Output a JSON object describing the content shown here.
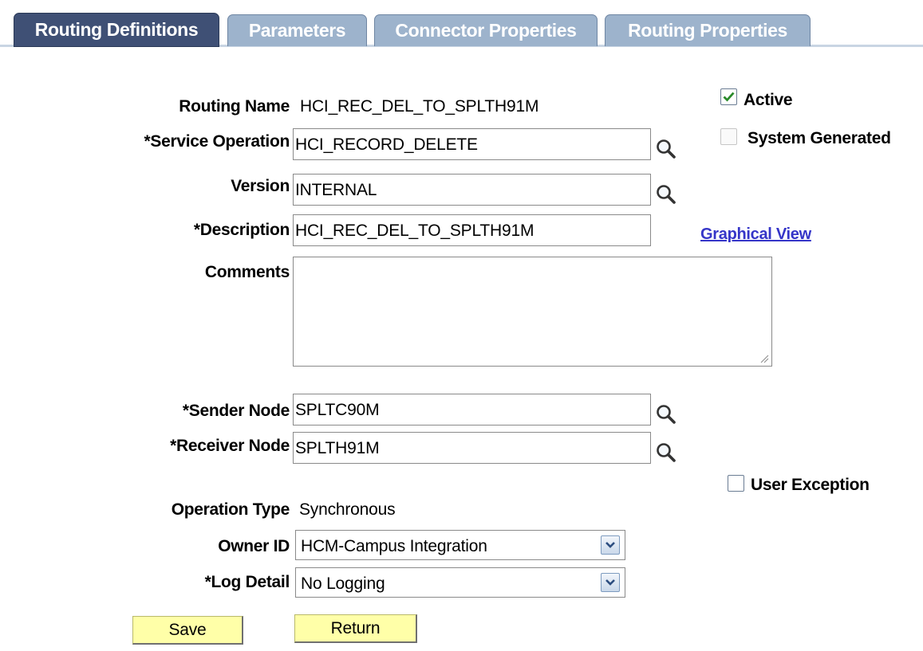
{
  "tabs": [
    {
      "label": "Routing Definitions",
      "active": true
    },
    {
      "label": "Parameters",
      "active": false
    },
    {
      "label": "Connector Properties",
      "active": false
    },
    {
      "label": "Routing Properties",
      "active": false
    }
  ],
  "form": {
    "routing_name": {
      "label": "Routing Name",
      "value": "HCI_REC_DEL_TO_SPLTH91M"
    },
    "service_operation": {
      "label": "*Service Operation",
      "value": "HCI_RECORD_DELETE"
    },
    "version": {
      "label": "Version",
      "value": "INTERNAL"
    },
    "description": {
      "label": "*Description",
      "value": "HCI_REC_DEL_TO_SPLTH91M"
    },
    "comments": {
      "label": "Comments",
      "value": ""
    },
    "sender_node": {
      "label": "*Sender Node",
      "value": "SPLTC90M"
    },
    "receiver_node": {
      "label": "*Receiver Node",
      "value": "SPLTH91M"
    },
    "operation_type": {
      "label": "Operation Type",
      "value": "Synchronous"
    },
    "owner_id": {
      "label": "Owner ID",
      "value": "HCM-Campus Integration"
    },
    "log_detail": {
      "label": "*Log Detail",
      "value": "No Logging"
    }
  },
  "checkboxes": {
    "active": {
      "label": "Active",
      "checked": true
    },
    "system_generated": {
      "label": "System Generated",
      "checked": false,
      "disabled": true
    },
    "user_exception": {
      "label": "User Exception",
      "checked": false
    }
  },
  "links": {
    "graphical_view": "Graphical View"
  },
  "buttons": {
    "save": "Save",
    "return": "Return"
  },
  "colors": {
    "active_tab": "#3f5075",
    "inactive_tab": "#9db3cc",
    "button_bg": "#ffffa8",
    "link": "#3535c8"
  }
}
